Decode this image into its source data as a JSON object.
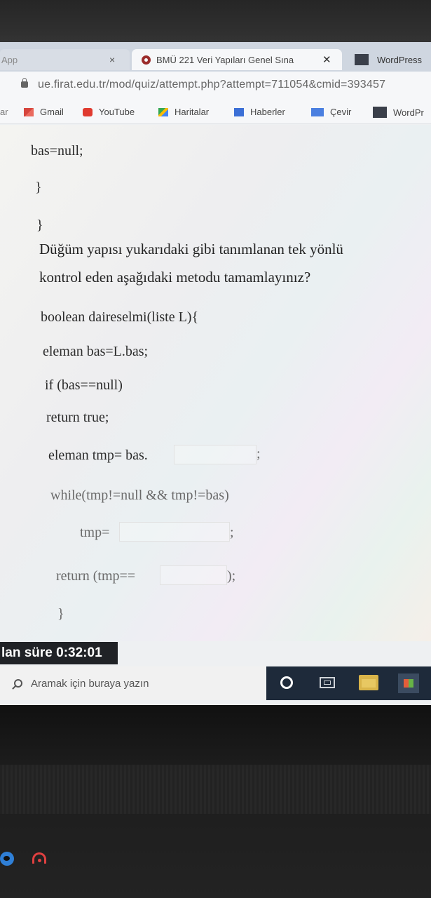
{
  "browser": {
    "tabs": [
      {
        "label": "App",
        "close": "×"
      },
      {
        "label": "BMÜ 221 Veri Yapıları Genel Sına",
        "close": "✕"
      },
      {
        "label": "WordPress"
      }
    ],
    "url": "ue.firat.edu.tr/mod/quiz/attempt.php?attempt=711054&cmid=393457",
    "bookmarks": [
      {
        "label": "ar",
        "icon": "app-icon"
      },
      {
        "label": "Gmail",
        "icon": "gmail-icon",
        "color": "#d6453d"
      },
      {
        "label": "YouTube",
        "icon": "youtube-icon",
        "color": "#e03a2f"
      },
      {
        "label": "Haritalar",
        "icon": "maps-icon",
        "color": "#34a853"
      },
      {
        "label": "Haberler",
        "icon": "news-icon",
        "color": "#3b6fd6"
      },
      {
        "label": "Çevir",
        "icon": "translate-icon",
        "color": "#4a7fe0"
      },
      {
        "label": "WordPr",
        "icon": "wordpress-icon",
        "color": "#3a3f4a"
      }
    ]
  },
  "quiz": {
    "code_top": [
      "bas=null;",
      "}",
      "}"
    ],
    "question_line1": "Düğüm yapısı yukarıdaki gibi tanımlanan tek yönlü",
    "question_line2": "kontrol eden aşağıdaki metodu tamamlayınız?",
    "code_lines": [
      "boolean daireselmi(liste L){",
      "eleman bas=L.bas;",
      "if (bas==null)",
      "return true;",
      "eleman tmp= bas.",
      ";",
      "while(tmp!=null && tmp!=bas)",
      "tmp=",
      ";",
      "return (tmp==",
      ");",
      "}"
    ]
  },
  "timer": {
    "label": "lan süre",
    "value": "0:32:01"
  },
  "taskbar": {
    "search_placeholder": "Aramak için buraya yazın"
  }
}
